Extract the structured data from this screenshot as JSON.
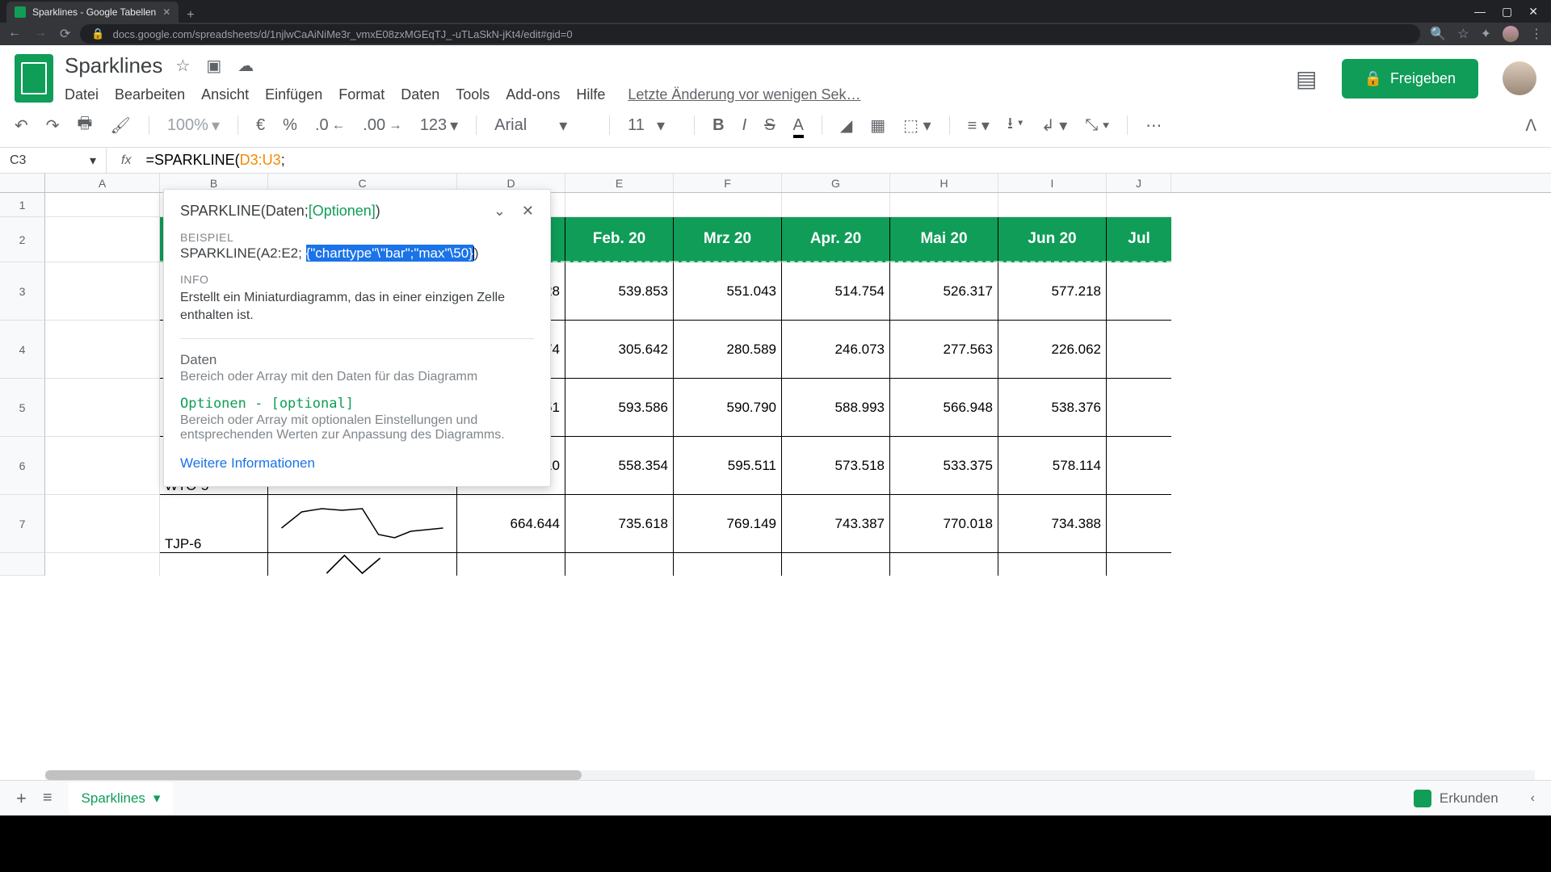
{
  "browser": {
    "tab_title": "Sparklines - Google Tabellen",
    "url": "docs.google.com/spreadsheets/d/1njlwCaAiNiMe3r_vmxE08zxMGEqTJ_-uTLaSkN-jKt4/edit#gid=0"
  },
  "doc": {
    "title": "Sparklines",
    "last_edit": "Letzte Änderung vor wenigen Sek…",
    "share_label": "Freigeben"
  },
  "menu": [
    "Datei",
    "Bearbeiten",
    "Ansicht",
    "Einfügen",
    "Format",
    "Daten",
    "Tools",
    "Add-ons",
    "Hilfe"
  ],
  "toolbar": {
    "zoom": "100%",
    "currency": "€",
    "percent": "%",
    "dec_dec": ".0",
    "dec_inc": ".00",
    "numfmt": "123",
    "font": "Arial",
    "size": "11"
  },
  "namebox": "C3",
  "formula": {
    "prefix": "=SPARKLINE(",
    "range": "D3:U3",
    "suffix": ";"
  },
  "columns": [
    "A",
    "B",
    "C",
    "D",
    "E",
    "F",
    "G",
    "H",
    "I",
    "J"
  ],
  "header_cells": {
    "E": "Feb. 20",
    "F": "Mrz 20",
    "G": "Apr. 20",
    "H": "Mai 20",
    "I": "Jun 20",
    "J": "Jul"
  },
  "rows_data": {
    "r3": {
      "D_tail": "28",
      "E": "539.853",
      "F": "551.043",
      "G": "514.754",
      "H": "526.317",
      "I": "577.218"
    },
    "r4": {
      "D_tail": "74",
      "E": "305.642",
      "F": "280.589",
      "G": "246.073",
      "H": "277.563",
      "I": "226.062"
    },
    "r5": {
      "D_tail": "51",
      "E": "593.586",
      "F": "590.790",
      "G": "588.993",
      "H": "566.948",
      "I": "538.376"
    },
    "r6": {
      "B": "WTO-5",
      "D": "570.210",
      "E": "558.354",
      "F": "595.511",
      "G": "573.518",
      "H": "533.375",
      "I": "578.114"
    },
    "r7": {
      "B": "TJP-6",
      "D": "664.644",
      "E": "735.618",
      "F": "769.149",
      "G": "743.387",
      "H": "770.018",
      "I": "734.388"
    }
  },
  "popover": {
    "sig_prefix": "SPARKLINE(Daten; ",
    "sig_opt": "[Optionen]",
    "sig_suffix": ")",
    "beispiel_label": "BEISPIEL",
    "example_prefix": "SPARKLINE(A2:E2; ",
    "example_hl": "{\"charttype\"\\\"bar\";\"max\"\\50}",
    "example_suffix": ")",
    "info_label": "INFO",
    "info_text": "Erstellt ein Miniaturdiagramm, das in einer einzigen Zelle enthalten ist.",
    "daten_label": "Daten",
    "daten_desc": "Bereich oder Array mit den Daten für das Diagramm",
    "optionen_label": "Optionen - [optional]",
    "optionen_desc": "Bereich oder Array mit optionalen Einstellungen und entsprechenden Werten zur Anpassung des Diagramms.",
    "link": "Weitere Informationen"
  },
  "sheet_tab": "Sparklines",
  "explore": "Erkunden",
  "chart_data": [
    {
      "type": "line",
      "row": "WTO-5",
      "values": [
        570210,
        558354,
        595511,
        573518,
        533375,
        578114
      ]
    },
    {
      "type": "line",
      "row": "TJP-6",
      "values": [
        664644,
        735618,
        769149,
        743387,
        770018,
        734388
      ]
    }
  ]
}
